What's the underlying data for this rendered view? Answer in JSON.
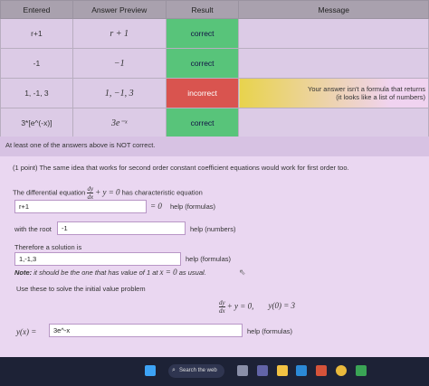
{
  "table": {
    "headers": [
      "Entered",
      "Answer Preview",
      "Result",
      "Message"
    ],
    "rows": [
      {
        "entered": "r+1",
        "preview": "r + 1",
        "result": "correct",
        "message": ""
      },
      {
        "entered": "-1",
        "preview": "−1",
        "result": "correct",
        "message": ""
      },
      {
        "entered": "1, -1, 3",
        "preview": "1, −1, 3",
        "result": "incorrect",
        "message_line1": "Your answer isn't a formula that returns",
        "message_line2": "(it looks like a list of numbers)"
      },
      {
        "entered": "3*[e^(-x)]",
        "preview": "3e⁻ˣ",
        "result": "correct",
        "message": ""
      }
    ]
  },
  "alert": "At least one of the answers above is NOT correct.",
  "problem": {
    "intro": "(1 point) The same idea that works for second order constant coefficient equations would work for first order too.",
    "de_prefix": "The differential equation",
    "de_frac_num": "dy",
    "de_frac_den": "dx",
    "de_rest": "+ y = 0",
    "de_suffix": "has characteristic equation",
    "char_value": "r+1",
    "char_eq_suffix": "= 0",
    "help_formulas": "help (formulas)",
    "root_label": "with the root",
    "root_value": "-1",
    "help_numbers": "help (numbers)",
    "solution_label": "Therefore a solution is",
    "solution_value": "1,-1,3",
    "note_bold": "Note:",
    "note_text": "it should be the one that has value of 1 at",
    "note_math": "x = 0",
    "note_end": "as usual.",
    "ivp_label": "Use these to solve the initial value problem",
    "ivp_num": "dy",
    "ivp_den": "dx",
    "ivp_eq": "+ y = 0,",
    "ivp_ic": "y(0) = 3",
    "y_label": "y(x) =",
    "y_value": "3e^-x",
    "help_formulas2": "help (formulas)"
  },
  "taskbar": {
    "search_label": "Search the web",
    "icons": [
      "windows-icon",
      "search-icon",
      "task-view-icon",
      "teams-icon",
      "file-explorer-icon",
      "edge-icon",
      "store-icon",
      "chrome-icon",
      "app-icon"
    ]
  },
  "colors": {
    "correct": "#58c47a",
    "incorrect": "#d9544f",
    "warning": "#e8d34c"
  }
}
